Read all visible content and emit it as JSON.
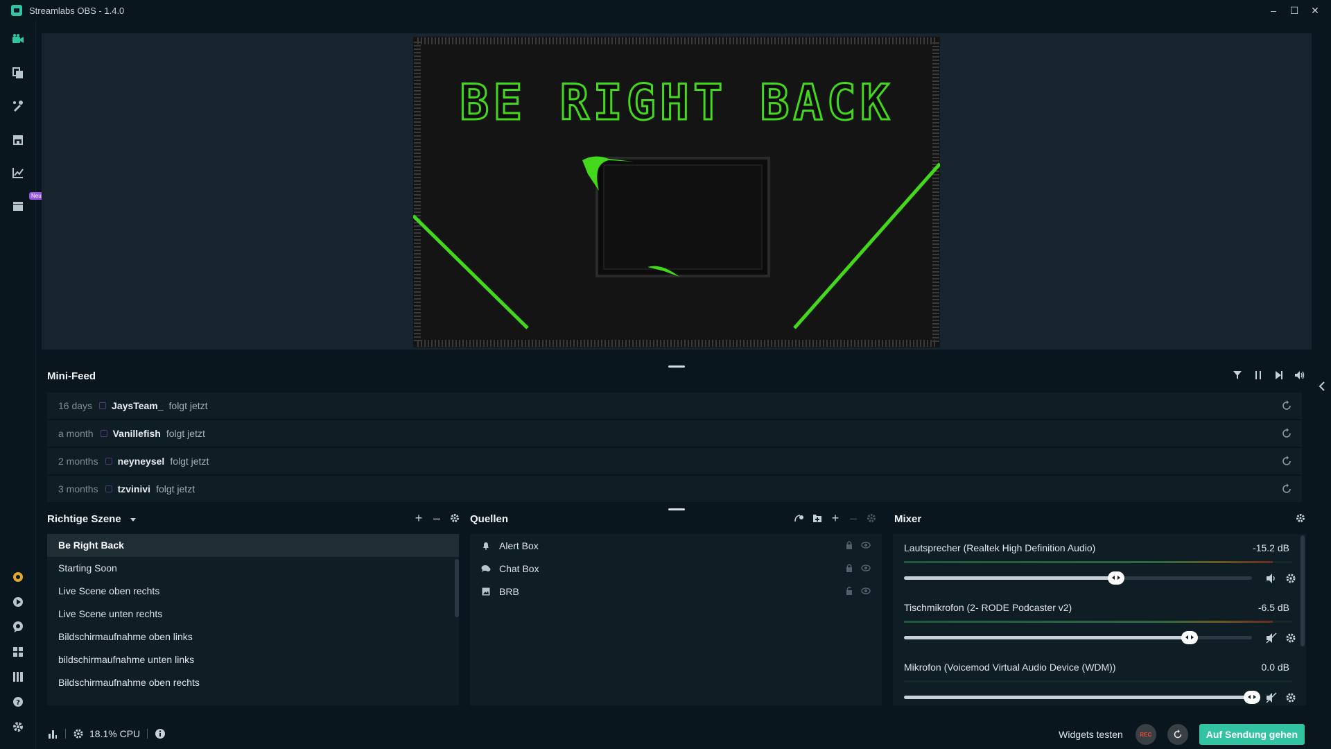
{
  "window": {
    "title": "Streamlabs OBS - 1.4.0",
    "controls": [
      "–",
      "☐",
      "✕"
    ]
  },
  "nav": {
    "new_badge": "Neu",
    "top_icons": [
      "video-camera-icon",
      "layout-icon",
      "themes-icon",
      "store-icon",
      "analytics-icon",
      "highlighter-icon"
    ],
    "bottom_icons": [
      "cloudbot-icon",
      "alert-icon",
      "chat-icon",
      "dashboard-icon",
      "apps-icon",
      "help-icon",
      "settings-icon"
    ]
  },
  "preview": {
    "overlay_text": "BE RIGHT BACK",
    "accent": "#43d81c"
  },
  "minifeed": {
    "title": "Mini-Feed",
    "events": [
      {
        "time": "16 days",
        "user": "JaysTeam_",
        "action": "folgt jetzt"
      },
      {
        "time": "a month",
        "user": "Vanillefish",
        "action": "folgt jetzt"
      },
      {
        "time": "2 months",
        "user": "neyneysel",
        "action": "folgt jetzt"
      },
      {
        "time": "3 months",
        "user": "tzvinivi",
        "action": "folgt jetzt"
      }
    ]
  },
  "scenes": {
    "title": "Richtige Szene",
    "items": [
      "Be Right Back",
      "Starting Soon",
      "Live Scene oben rechts",
      "Live Scene unten rechts",
      "Bildschirmaufnahme oben links",
      "bildschirmaufnahme unten links",
      "Bildschirmaufnahme oben rechts"
    ],
    "selected_index": 0
  },
  "sources": {
    "title": "Quellen",
    "items": [
      {
        "label": "Alert Box",
        "icon": "bell-icon"
      },
      {
        "label": "Chat Box",
        "icon": "chat-icon"
      },
      {
        "label": "BRB",
        "icon": "image-icon"
      }
    ]
  },
  "mixer": {
    "title": "Mixer",
    "channels": [
      {
        "name": "Lautsprecher (Realtek High Definition Audio)",
        "db": "-15.2 dB",
        "level": 0.61,
        "meter": 0.95,
        "muted": false
      },
      {
        "name": "Tischmikrofon (2- RODE Podcaster v2)",
        "db": "-6.5 dB",
        "level": 0.82,
        "meter": 0.95,
        "muted": true
      },
      {
        "name": "Mikrofon (Voicemod Virtual Audio Device (WDM))",
        "db": "0.0 dB",
        "level": 1.0,
        "meter": 0.0,
        "muted": true
      }
    ]
  },
  "status": {
    "cpu": "18.1% CPU",
    "widgets_label": "Widgets testen",
    "rec_label": "REC",
    "go_live": "Auf Sendung gehen",
    "accent": "#31c3a2"
  }
}
